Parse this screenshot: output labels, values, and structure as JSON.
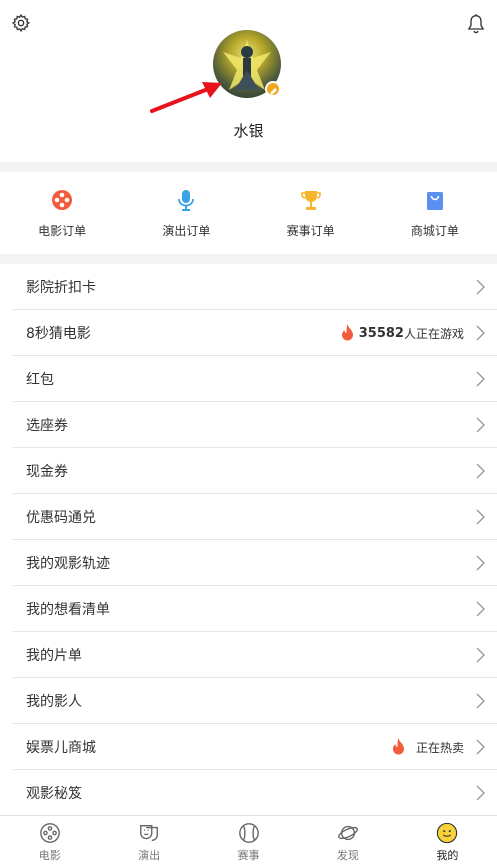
{
  "header": {
    "settings_icon": "gear-icon",
    "notifications_icon": "bell-icon",
    "username": "水银"
  },
  "orders": [
    {
      "label": "电影订单",
      "icon": "film-reel-icon",
      "color": "#f25c3b"
    },
    {
      "label": "演出订单",
      "icon": "microphone-icon",
      "color": "#3aa3e3"
    },
    {
      "label": "赛事订单",
      "icon": "trophy-icon",
      "color": "#f5b52e"
    },
    {
      "label": "商城订单",
      "icon": "shopping-bag-icon",
      "color": "#5b8ff0"
    }
  ],
  "menu": [
    {
      "label": "影院折扣卡"
    },
    {
      "label": "8秒猜电影",
      "count": "35582",
      "suffix": "人正在游戏"
    },
    {
      "label": "红包"
    },
    {
      "label": "选座券"
    },
    {
      "label": "现金券"
    },
    {
      "label": "优惠码通兑"
    },
    {
      "label": "我的观影轨迹"
    },
    {
      "label": "我的想看清单"
    },
    {
      "label": "我的片单"
    },
    {
      "label": "我的影人"
    },
    {
      "label": "娱票儿商城",
      "suffix": "正在热卖"
    },
    {
      "label": "观影秘笈"
    }
  ],
  "tabs": [
    {
      "label": "电影",
      "icon": "film-icon"
    },
    {
      "label": "演出",
      "icon": "theater-mask-icon"
    },
    {
      "label": "赛事",
      "icon": "baseball-icon"
    },
    {
      "label": "发现",
      "icon": "planet-icon"
    },
    {
      "label": "我的",
      "icon": "smiley-face-icon",
      "active": true
    }
  ],
  "colors": {
    "flame": "#f25c3b",
    "active_tab": "#f7d23a",
    "badge": "#f2a71b",
    "arrow": "#e8121b"
  }
}
